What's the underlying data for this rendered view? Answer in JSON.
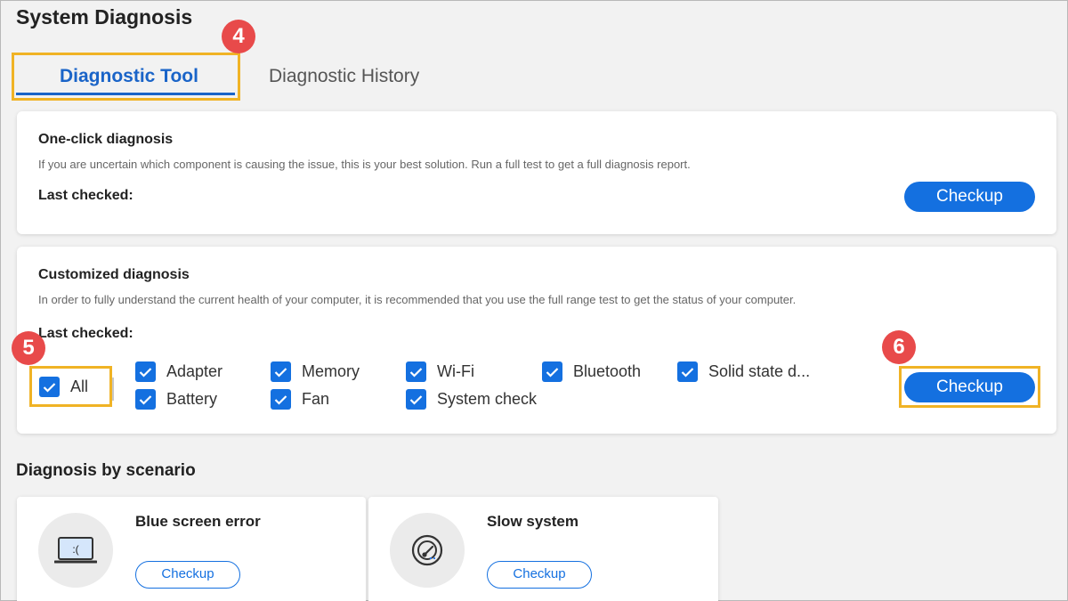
{
  "page": {
    "title": "System Diagnosis"
  },
  "tabs": [
    {
      "label": "Diagnostic Tool",
      "active": true
    },
    {
      "label": "Diagnostic History",
      "active": false
    }
  ],
  "annotations": {
    "step4": "4",
    "step5": "5",
    "step6": "6",
    "highlight_color": "#f0b325",
    "badge_color": "#e84a4a"
  },
  "one_click": {
    "title": "One-click diagnosis",
    "description": "If you are uncertain which component is causing the issue, this is your best solution. Run a full test to get a full diagnosis report.",
    "last_checked_label": "Last checked:",
    "button_label": "Checkup"
  },
  "customized": {
    "title": "Customized diagnosis",
    "description": "In order to fully understand the current health of your computer, it is recommended that you use the full range test to get the status of your computer.",
    "last_checked_label": "Last checked:",
    "all_label": "All",
    "items": [
      {
        "label": "Adapter",
        "checked": true
      },
      {
        "label": "Memory",
        "checked": true
      },
      {
        "label": "Wi-Fi",
        "checked": true
      },
      {
        "label": "Bluetooth",
        "checked": true
      },
      {
        "label": "Solid state d...",
        "checked": true
      },
      {
        "label": "Battery",
        "checked": true
      },
      {
        "label": "Fan",
        "checked": true
      },
      {
        "label": "System check",
        "checked": true
      }
    ],
    "button_label": "Checkup"
  },
  "scenarios": {
    "title": "Diagnosis by scenario",
    "items": [
      {
        "title": "Blue screen error",
        "icon": "blue-screen-laptop-icon",
        "button_label": "Checkup"
      },
      {
        "title": "Slow system",
        "icon": "speedometer-icon",
        "button_label": "Checkup"
      }
    ]
  },
  "colors": {
    "accent": "#1470e0",
    "tab_active": "#1a64c8"
  }
}
